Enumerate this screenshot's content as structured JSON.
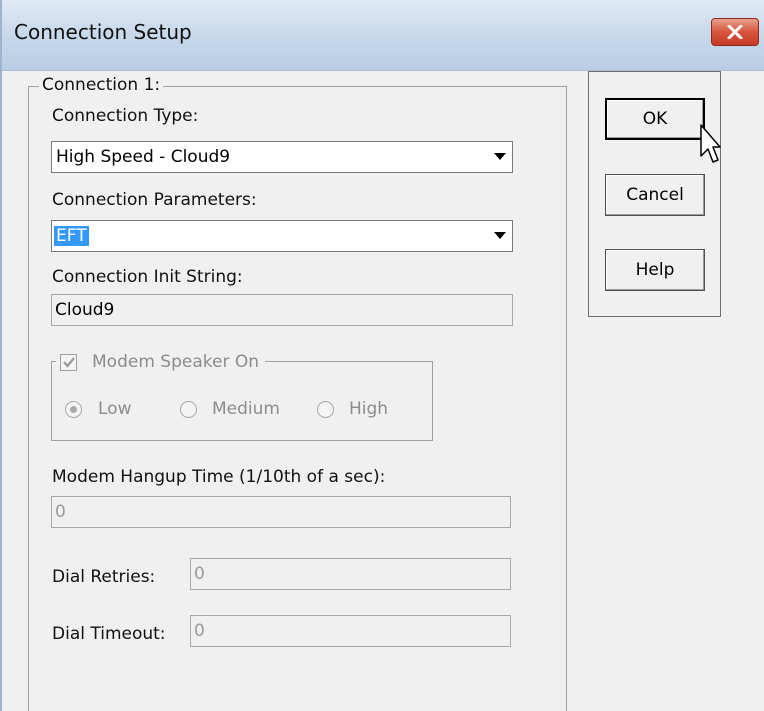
{
  "window": {
    "title": "Connection Setup",
    "close_icon": "close-x-icon"
  },
  "connection_group": {
    "legend": "Connection 1:",
    "connection_type": {
      "label": "Connection Type:",
      "value": "High Speed - Cloud9"
    },
    "connection_parameters": {
      "label": "Connection Parameters:",
      "value": "EFT"
    },
    "init_string": {
      "label": "Connection Init String:",
      "value": "Cloud9"
    },
    "modem_speaker": {
      "label": "Modem Speaker On",
      "checked": true,
      "options": [
        {
          "label": "Low",
          "selected": true
        },
        {
          "label": "Medium",
          "selected": false
        },
        {
          "label": "High",
          "selected": false
        }
      ]
    },
    "hangup_time": {
      "label": "Modem Hangup Time (1/10th of a sec):",
      "value": "0"
    },
    "dial_retries": {
      "label": "Dial Retries:",
      "value": "0"
    },
    "dial_timeout": {
      "label": "Dial Timeout:",
      "value": "0"
    }
  },
  "buttons": {
    "ok": "OK",
    "cancel": "Cancel",
    "help": "Help"
  },
  "colors": {
    "selection": "#3399ff",
    "close_button": "#c63a24",
    "disabled_text": "#8c8c8c"
  }
}
